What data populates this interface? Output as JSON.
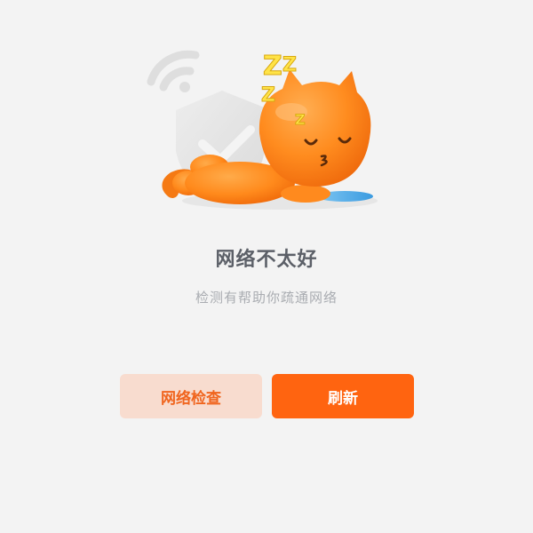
{
  "illustration": {
    "icons": [
      "wifi-icon",
      "shield-check-icon",
      "sleeping-cat-mascot"
    ],
    "zzz": "ZZZ"
  },
  "status": {
    "title": "网络不太好",
    "subtitle": "检测有帮助你疏通网络"
  },
  "actions": {
    "network_check_label": "网络检查",
    "refresh_label": "刷新"
  },
  "colors": {
    "background": "#f3f3f3",
    "accent": "#ff6410",
    "accent_light": "#f8dccf",
    "title_text": "#5c6068",
    "subtitle_text": "#a9acb1"
  }
}
